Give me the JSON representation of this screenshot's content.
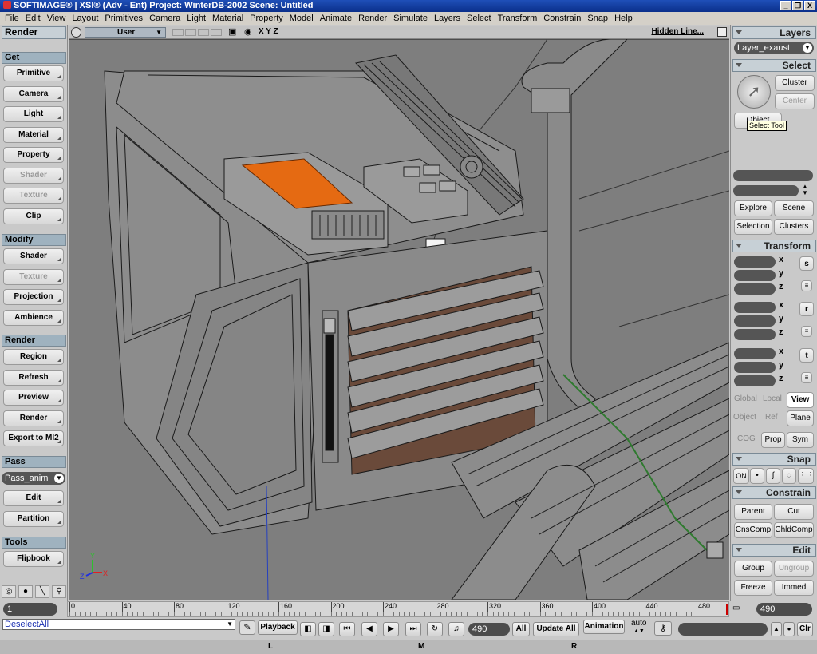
{
  "window": {
    "title": "SOFTIMAGE® | XSI® (Adv - Ent) Project: WinterDB-2002    Scene: Untitled",
    "buttons": [
      "_",
      "❐",
      "X"
    ]
  },
  "menu": [
    "File",
    "Edit",
    "View",
    "Layout",
    "Primitives",
    "Camera",
    "Light",
    "Material",
    "Property",
    "Model",
    "Animate",
    "Render",
    "Simulate",
    "Layers",
    "Select",
    "Transform",
    "Constrain",
    "Snap",
    "Help"
  ],
  "left": {
    "title": "Render",
    "get": {
      "label": "Get",
      "buttons": [
        "Primitive",
        "Camera",
        "Light",
        "Material",
        "Property",
        "Shader",
        "Texture",
        "Clip"
      ]
    },
    "modify": {
      "label": "Modify",
      "buttons": [
        "Shader",
        "Texture",
        "Projection",
        "Ambience"
      ]
    },
    "render": {
      "label": "Render",
      "buttons": [
        "Region",
        "Refresh",
        "Preview",
        "Render",
        "Export to MI2"
      ]
    },
    "pass": {
      "label": "Pass",
      "value": "Pass_anim",
      "buttons": [
        "Edit",
        "Partition"
      ]
    },
    "tools": {
      "label": "Tools",
      "buttons": [
        "Flipbook"
      ]
    }
  },
  "viewport": {
    "camera": "User",
    "axes": "X Y Z",
    "mode": "Hidden Line..."
  },
  "right": {
    "layers": {
      "label": "Layers",
      "value": "Layer_exaust"
    },
    "select": {
      "label": "Select",
      "cluster": "Cluster",
      "center": "Center",
      "object": "Object",
      "tooltip": "Select Tool",
      "explore": "Explore",
      "scene": "Scene",
      "selection": "Selection",
      "clusters": "Clusters"
    },
    "transform": {
      "label": "Transform",
      "axes": [
        "x",
        "y",
        "z"
      ],
      "icons": [
        "s",
        "r",
        "t"
      ],
      "global": "Global",
      "local": "Local",
      "view": "View",
      "object": "Object",
      "ref": "Ref",
      "plane": "Plane",
      "cog": "COG",
      "prop": "Prop",
      "sym": "Sym"
    },
    "snap": {
      "label": "Snap",
      "on": "ON"
    },
    "constrain": {
      "label": "Constrain",
      "parent": "Parent",
      "cut": "Cut",
      "cnscomp": "CnsComp",
      "chldcomp": "ChldComp"
    },
    "edit": {
      "label": "Edit",
      "group": "Group",
      "ungroup": "Ungroup",
      "freeze": "Freeze",
      "immed": "Immed"
    }
  },
  "timeline": {
    "start": "1",
    "end": "490",
    "ticks": [
      "0",
      "40",
      "80",
      "120",
      "160",
      "200",
      "240",
      "280",
      "320",
      "360",
      "400",
      "440",
      "480"
    ]
  },
  "command": {
    "script": "DeselectAll",
    "playback": "Playback",
    "frame": "490",
    "all": "All",
    "update": "Update All",
    "animation": "Animation",
    "auto": "auto",
    "clr": "Clr"
  },
  "status": {
    "l": "L",
    "m": "M",
    "r": "R"
  }
}
